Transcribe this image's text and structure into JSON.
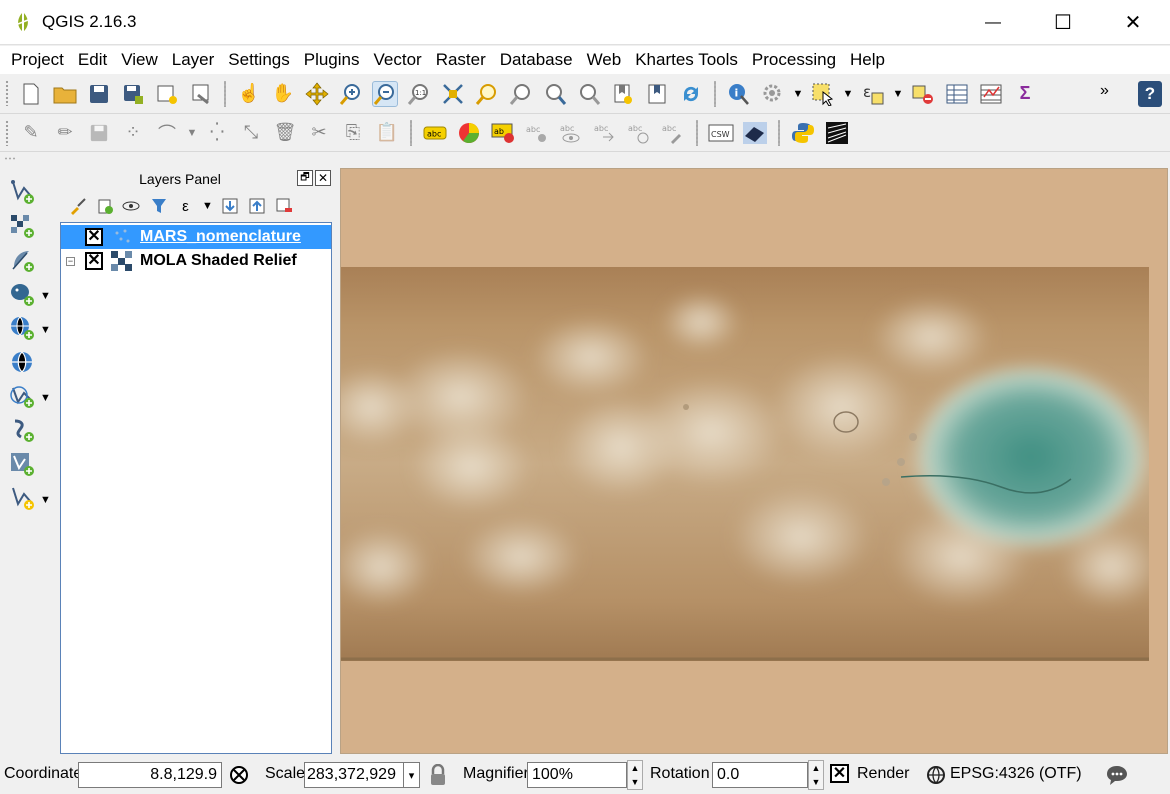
{
  "window": {
    "title": "QGIS 2.16.3",
    "minimize_glyph": "—",
    "maximize_glyph": "☐",
    "close_glyph": "✕"
  },
  "menu": [
    "Project",
    "Edit",
    "View",
    "Layer",
    "Settings",
    "Plugins",
    "Vector",
    "Raster",
    "Database",
    "Web",
    "Khartes Tools",
    "Processing",
    "Help"
  ],
  "toolbar_more": "»",
  "help_icon_label": "?",
  "layers_panel": {
    "title": "Layers Panel",
    "float_glyph": "🗗",
    "close_glyph": "✕",
    "layers": [
      {
        "name": "MARS_nomenclature",
        "visible": true,
        "selected": true,
        "icon": "point-layer-icon"
      },
      {
        "name": "MOLA Shaded Relief",
        "visible": true,
        "selected": false,
        "icon": "raster-layer-icon"
      }
    ],
    "check_glyph": "✕",
    "collapse_glyph": "−"
  },
  "map": {
    "background_color": "#d4b08a"
  },
  "statusbar": {
    "coordinate_label": "Coordinate",
    "coordinate_value": "8.8,129.9",
    "scale_label": "Scale",
    "scale_value": "283,372,929",
    "magnifier_label": "Magnifier",
    "magnifier_value": "100%",
    "rotation_label": "Rotation",
    "rotation_value": "0.0",
    "render_label": "Render",
    "render_checked": true,
    "crs_label": "EPSG:4326 (OTF)",
    "dropdown_glyph": "▾",
    "spin_up": "▲",
    "spin_down": "▼"
  },
  "colors": {
    "selection": "#3399ff",
    "map_background": "#d4b08a",
    "qgis_green": "#589632"
  }
}
